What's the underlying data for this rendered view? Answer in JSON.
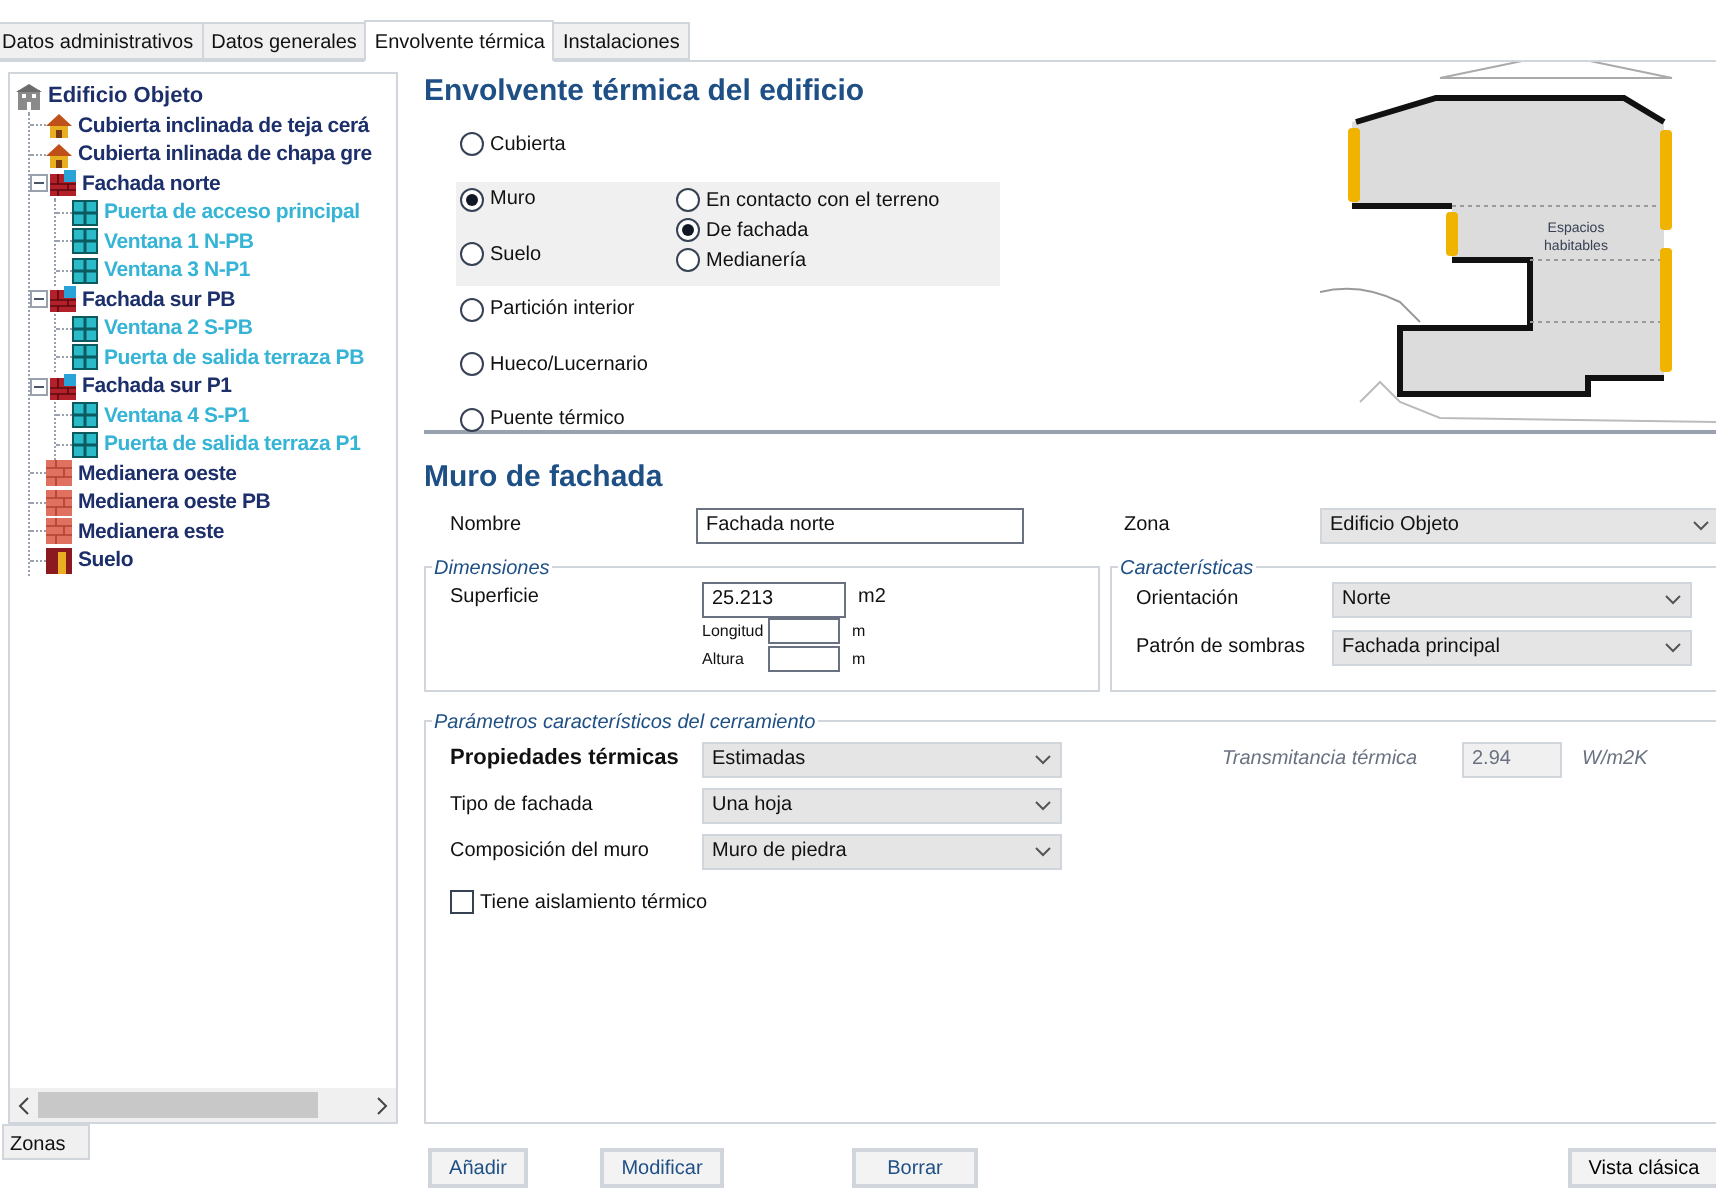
{
  "tabs": [
    {
      "label": "Datos administrativos",
      "selected": false
    },
    {
      "label": "Datos generales",
      "selected": false
    },
    {
      "label": "Envolvente térmica",
      "selected": true
    },
    {
      "label": "Instalaciones",
      "selected": false
    }
  ],
  "tree": {
    "root": {
      "label": "Edificio Objeto",
      "kind": "building"
    },
    "items": [
      {
        "label": "Cubierta inclinada de teja cerá",
        "kind": "roof"
      },
      {
        "label": "Cubierta inlinada de chapa gre",
        "kind": "roof"
      },
      {
        "label": "Fachada norte",
        "kind": "wall",
        "expanded": true,
        "children": [
          {
            "label": "Puerta de acceso principal",
            "kind": "opening"
          },
          {
            "label": "Ventana 1 N-PB",
            "kind": "opening"
          },
          {
            "label": "Ventana 3 N-P1",
            "kind": "opening"
          }
        ]
      },
      {
        "label": "Fachada sur PB",
        "kind": "wall",
        "expanded": true,
        "children": [
          {
            "label": "Ventana 2 S-PB",
            "kind": "opening"
          },
          {
            "label": "Puerta de salida terraza PB",
            "kind": "opening"
          }
        ]
      },
      {
        "label": "Fachada sur P1",
        "kind": "wall",
        "expanded": true,
        "children": [
          {
            "label": "Ventana 4 S-P1",
            "kind": "opening"
          },
          {
            "label": "Puerta de salida terraza P1",
            "kind": "opening"
          }
        ]
      },
      {
        "label": "Medianera oeste",
        "kind": "party-wall"
      },
      {
        "label": "Medianera oeste PB",
        "kind": "party-wall"
      },
      {
        "label": "Medianera este",
        "kind": "party-wall"
      },
      {
        "label": "Suelo",
        "kind": "floor"
      }
    ]
  },
  "left_tab": "Zonas",
  "envelope": {
    "title": "Envolvente térmica del edificio",
    "options": [
      {
        "label": "Cubierta",
        "selected": false
      },
      {
        "label": "Muro",
        "selected": true,
        "suboptions": [
          {
            "label": "En contacto con el terreno",
            "selected": false
          },
          {
            "label": "De fachada",
            "selected": true
          },
          {
            "label": "Medianería",
            "selected": false
          }
        ]
      },
      {
        "label": "Suelo",
        "selected": false
      },
      {
        "label": "Partición interior",
        "selected": false
      },
      {
        "label": "Hueco/Lucernario",
        "selected": false
      },
      {
        "label": "Puente térmico",
        "selected": false
      }
    ],
    "diagram": {
      "label": "Espacios habitables"
    }
  },
  "element": {
    "title": "Muro de fachada",
    "nombre": {
      "label": "Nombre",
      "value": "Fachada norte"
    },
    "zona": {
      "label": "Zona",
      "value": "Edificio Objeto"
    },
    "dimensiones": {
      "title": "Dimensiones",
      "superficie": {
        "label": "Superficie",
        "value": "25.213",
        "unit": "m2"
      },
      "longitud": {
        "label": "Longitud",
        "unit": "m"
      },
      "altura": {
        "label": "Altura",
        "unit": "m"
      }
    },
    "caracteristicas": {
      "title": "Características",
      "orientacion": {
        "label": "Orientación",
        "value": "Norte"
      },
      "patron": {
        "label": "Patrón de sombras",
        "value": "Fachada principal"
      }
    },
    "parametros": {
      "title": "Parámetros característicos del cerramiento",
      "propiedades": {
        "label": "Propiedades térmicas",
        "value": "Estimadas"
      },
      "tipo": {
        "label": "Tipo de fachada",
        "value": "Una hoja"
      },
      "composicion": {
        "label": "Composición del muro",
        "value": "Muro de piedra"
      },
      "transmitancia": {
        "label": "Transmitancia térmica",
        "value": "2.94",
        "unit": "W/m2K",
        "disabled": true
      },
      "aislamiento": {
        "label": "Tiene aislamiento térmico",
        "checked": false
      }
    }
  },
  "buttons": [
    "Añadir",
    "Modificar",
    "Borrar",
    "Vista clásica"
  ]
}
